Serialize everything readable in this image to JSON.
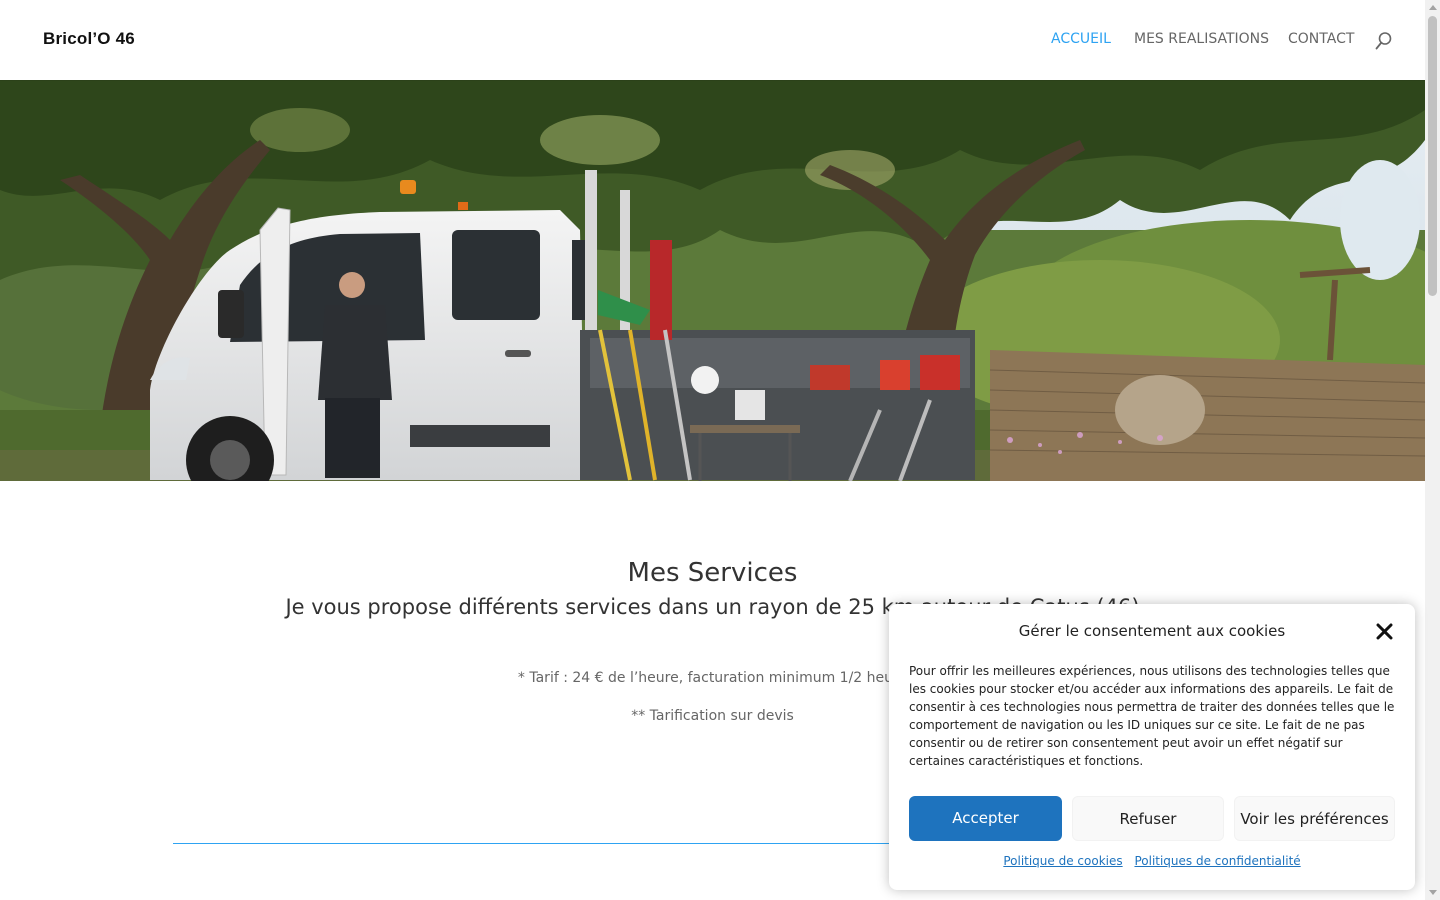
{
  "header": {
    "logo": "Bricol’O 46",
    "nav": [
      {
        "label": "ACCUEIL",
        "active": true
      },
      {
        "label": "MES REALISATIONS",
        "active": false
      },
      {
        "label": "CONTACT",
        "active": false
      }
    ],
    "search_icon": "search-icon"
  },
  "hero": {
    "image": "photo of a white pickup truck with tools under trees, man standing at open door"
  },
  "services": {
    "title": "Mes Services",
    "subtitle": "Je vous propose différents services dans un rayon de 25 km autour de Catus (46)",
    "tarif_1": "* Tarif : 24 € de l’heure, facturation minimum 1/2 heure",
    "tarif_2": "** Tarification sur devis"
  },
  "cookie_banner": {
    "title": "Gérer le consentement aux cookies",
    "text": "Pour offrir les meilleures expériences, nous utilisons des technologies telles que les cookies pour stocker et/ou accéder aux informations des appareils. Le fait de consentir à ces technologies nous permettra de traiter des données telles que le comportement de navigation ou les ID uniques sur ce site. Le fait de ne pas consentir ou de retirer son consentement peut avoir un effet négatif sur certaines caractéristiques et fonctions.",
    "accept_label": "Accepter",
    "refuse_label": "Refuser",
    "prefs_label": "Voir les préférences",
    "link_cookies": "Politique de cookies",
    "link_privacy": "Politiques de confidentialité"
  },
  "colors": {
    "accent": "#2ea3f2",
    "button_primary": "#1e73be"
  }
}
